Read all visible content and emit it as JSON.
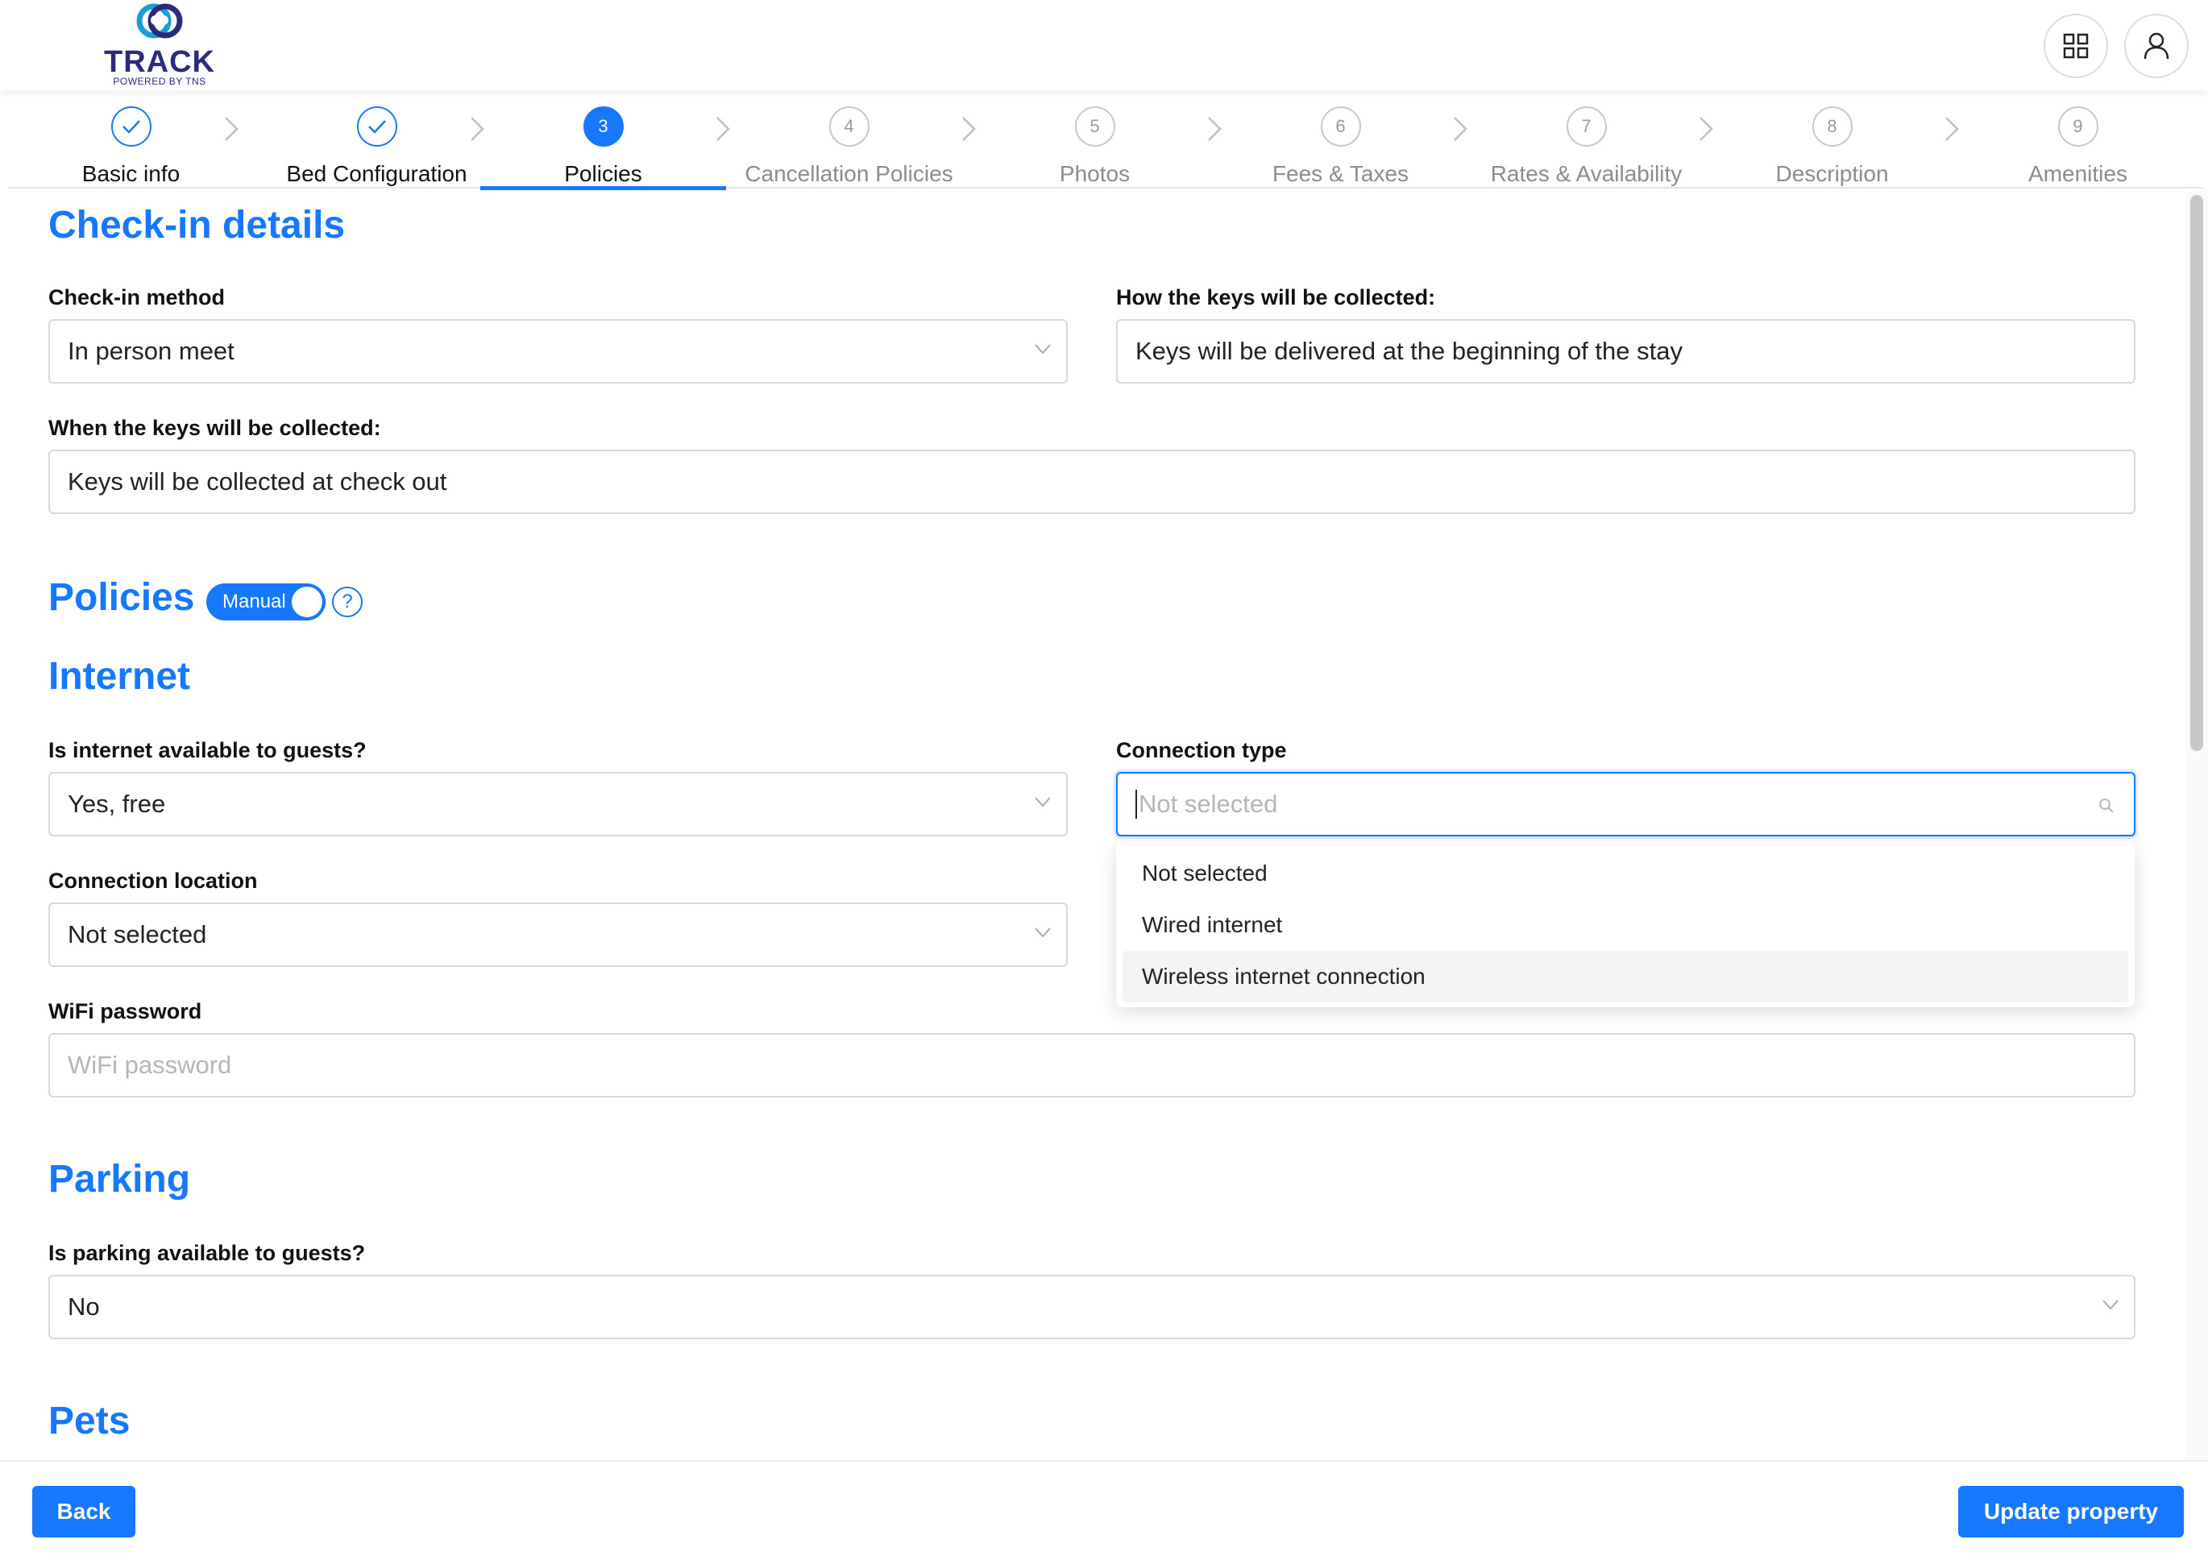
{
  "app": {
    "brand": "TRACK",
    "powered_by": "POWERED BY TNS"
  },
  "steps": [
    {
      "num": "1",
      "label": "Basic info",
      "state": "done"
    },
    {
      "num": "2",
      "label": "Bed Configuration",
      "state": "done"
    },
    {
      "num": "3",
      "label": "Policies",
      "state": "active"
    },
    {
      "num": "4",
      "label": "Cancellation Policies",
      "state": "pending"
    },
    {
      "num": "5",
      "label": "Photos",
      "state": "pending"
    },
    {
      "num": "6",
      "label": "Fees & Taxes",
      "state": "pending"
    },
    {
      "num": "7",
      "label": "Rates & Availability",
      "state": "pending"
    },
    {
      "num": "8",
      "label": "Description",
      "state": "pending"
    },
    {
      "num": "9",
      "label": "Amenities",
      "state": "pending"
    }
  ],
  "checkin": {
    "title": "Check-in details",
    "method_label": "Check-in method",
    "method_value": "In person meet",
    "keys_how_label": "How the keys will be collected:",
    "keys_how_value": "Keys will be delivered at the beginning of the stay",
    "keys_when_label": "When the keys will be collected:",
    "keys_when_value": "Keys will be collected at check out"
  },
  "policies": {
    "title": "Policies",
    "toggle_label": "Manual",
    "help_glyph": "?"
  },
  "internet": {
    "title": "Internet",
    "available_label": "Is internet available to guests?",
    "available_value": "Yes, free",
    "connection_type_label": "Connection type",
    "connection_type_placeholder": "Not selected",
    "connection_location_label": "Connection location",
    "connection_location_value": "Not selected",
    "wifi_label": "WiFi password",
    "wifi_placeholder": "WiFi password",
    "options": [
      "Not selected",
      "Wired internet",
      "Wireless internet connection"
    ],
    "highlighted_option": "Wireless internet connection"
  },
  "parking": {
    "title": "Parking",
    "available_label": "Is parking available to guests?",
    "available_value": "No"
  },
  "pets": {
    "title": "Pets"
  },
  "footer": {
    "back_label": "Back",
    "update_label": "Update property"
  },
  "colors": {
    "accent": "#1677ff",
    "brand": "#2b2b7c"
  },
  "icons": [
    "grid-icon",
    "user-icon",
    "check-icon",
    "chevron-right-icon",
    "chevron-down-icon",
    "search-icon",
    "help-icon"
  ]
}
